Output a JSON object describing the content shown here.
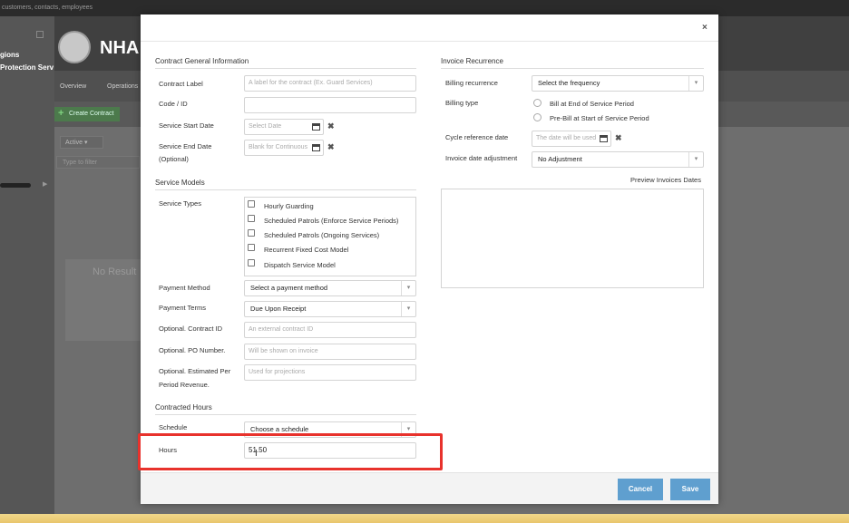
{
  "background": {
    "topbar_text": "customers, contacts, employees",
    "sidebar_items": [
      "gions",
      "Protection Serv"
    ],
    "header_name": "NHA",
    "nav_tabs": [
      "Overview",
      "Operations"
    ],
    "create_button": "Create Contract",
    "filter_active": "Active",
    "filter_placeholder": "Type to filter",
    "no_results": "No Result"
  },
  "modal": {
    "close_label": "×",
    "general": {
      "title": "Contract General Information",
      "contract_label": {
        "label": "Contract Label",
        "placeholder": "A label for the contract (Ex. Guard Services)"
      },
      "code": {
        "label": "Code / ID",
        "value": ""
      },
      "start_date": {
        "label": "Service Start Date",
        "placeholder": "Select Date"
      },
      "end_date": {
        "label_line1": "Service End Date",
        "label_line2": "(Optional)",
        "placeholder": "Blank for Continuous"
      }
    },
    "service_models": {
      "title": "Service Models",
      "types_label": "Service Types",
      "types": [
        "Hourly Guarding",
        "Scheduled Patrols (Enforce Service Periods)",
        "Scheduled Patrols (Ongoing Services)",
        "Recurrent Fixed Cost Model",
        "Dispatch Service Model"
      ],
      "payment_method": {
        "label": "Payment Method",
        "value": "Select a payment method"
      },
      "payment_terms": {
        "label": "Payment Terms",
        "value": "Due Upon Receipt"
      },
      "contract_id": {
        "label": "Optional. Contract ID",
        "placeholder": "An external contract ID"
      },
      "po_number": {
        "label": "Optional. PO Number.",
        "placeholder": "Will be shown on invoice"
      },
      "revenue": {
        "label_line1": "Optional. Estimated Per",
        "label_line2": "Period Revenue.",
        "placeholder": "Used for projections"
      }
    },
    "contracted_hours": {
      "title": "Contracted Hours",
      "schedule": {
        "label": "Schedule",
        "value": "Choose a schedule"
      },
      "hours": {
        "label": "Hours",
        "value": "51.50"
      }
    },
    "invoice": {
      "title": "Invoice Recurrence",
      "billing_recurrence": {
        "label": "Billing recurrence",
        "value": "Select the frequency"
      },
      "billing_type": {
        "label": "Billing type",
        "options": [
          "Bill at End of Service Period",
          "Pre-Bill at Start of Service Period"
        ]
      },
      "cycle_reference": {
        "label": "Cycle reference date",
        "placeholder": "The date will be used"
      },
      "date_adjustment": {
        "label": "Invoice date adjustment",
        "value": "No Adjustment"
      },
      "preview_link": "Preview Invoices Dates"
    },
    "footer": {
      "cancel": "Cancel",
      "save": "Save"
    }
  },
  "colors": {
    "primary_button": "#5f9fcf",
    "highlight": "#e8322c"
  }
}
